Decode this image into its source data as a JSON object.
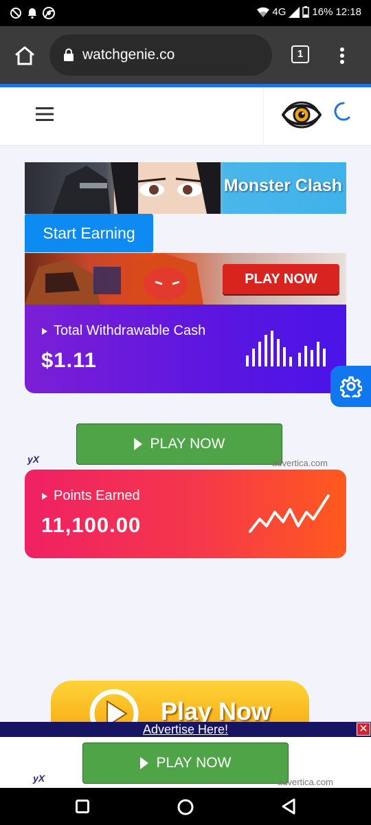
{
  "status_bar": {
    "network": "4G",
    "battery": "16%",
    "time": "12:18",
    "icons": [
      "do-not-disturb-icon",
      "notification-bell-icon",
      "chrome-icon",
      "wifi-icon",
      "signal-icon",
      "battery-icon"
    ]
  },
  "browser": {
    "url": "watchgenie.co",
    "tab_count": "1",
    "icons": [
      "home-icon",
      "lock-icon",
      "tabs-icon",
      "more-vert-icon"
    ]
  },
  "site_header": {
    "icons": [
      "hamburger-menu-icon",
      "watchgenie-eye-logo",
      "loading-spinner-icon"
    ]
  },
  "ads": {
    "banner1_text": "Monster Clash",
    "start_earning": "Start Earning",
    "banner2_button": "PLAY NOW",
    "play_now_button": "PLAY NOW",
    "yx_logo": "yX",
    "advertica": "advertica.com",
    "big_banner_text": "Play Now",
    "advertise_here": "Advertise Here!",
    "close": "✕"
  },
  "cards": {
    "cash": {
      "label": "Total Withdrawable Cash",
      "value": "$1.11",
      "icon": "bar-chart-icon"
    },
    "points": {
      "label": "Points Earned",
      "value": "11,100.00",
      "icon": "line-trend-icon"
    }
  },
  "colors": {
    "accent_blue": "#1a73e8",
    "cash_card_start": "#7b1fd6",
    "cash_card_end": "#4a14e8",
    "points_card_start": "#ef2164",
    "points_card_end": "#ff5a1e",
    "play_green": "#4ea447",
    "settings_fab": "#1077ee"
  }
}
